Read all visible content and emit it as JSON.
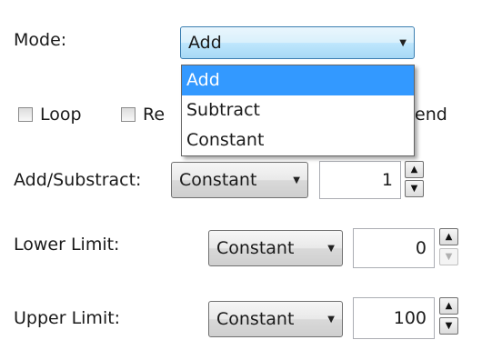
{
  "mode": {
    "label": "Mode:",
    "value": "Add",
    "options": [
      "Add",
      "Subtract",
      "Constant"
    ],
    "selected_index": 0
  },
  "checkboxes": [
    {
      "label": "Loop",
      "checked": false
    },
    {
      "label": "Re",
      "checked": false
    },
    {
      "label": "end",
      "checked": false
    }
  ],
  "add_subtract": {
    "label": "Add/Substract:",
    "type": "Constant",
    "value": "1"
  },
  "lower_limit": {
    "label": "Lower Limit:",
    "type": "Constant",
    "value": "0"
  },
  "upper_limit": {
    "label": "Upper Limit:",
    "type": "Constant",
    "value": "100"
  },
  "icons": {
    "dropdown_arrow": "chevron-down-icon",
    "spin_up": "arrow-up-icon",
    "spin_down": "arrow-down-icon"
  }
}
